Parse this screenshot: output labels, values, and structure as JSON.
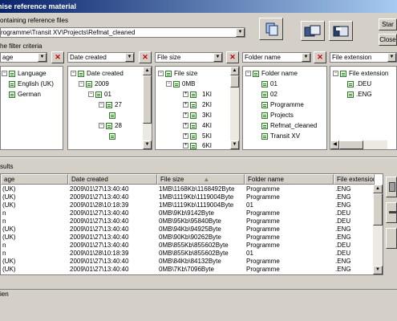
{
  "window": {
    "title": "anise reference material"
  },
  "reference": {
    "label": "ontaining reference files",
    "path": "rogramme\\Transit XV\\Projects\\Refmat_cleaned"
  },
  "buttons": {
    "start": "Star",
    "close": "Close"
  },
  "filter": {
    "label": "he filter criteria",
    "combos": [
      "age",
      "Date created",
      "File size",
      "Folder name",
      "File extension"
    ]
  },
  "trees": {
    "language": {
      "root": "Language",
      "items": [
        "English (UK)",
        "German"
      ]
    },
    "date": {
      "root": "Date created",
      "year": "2009",
      "month": "01",
      "day1": "27",
      "day2": "28"
    },
    "size": {
      "root": "File size",
      "first": "0MB",
      "items": [
        "1KI",
        "2KI",
        "3KI",
        "4KI",
        "5KI",
        "6KI"
      ]
    },
    "folder": {
      "root": "Folder name",
      "items": [
        "01",
        "02",
        "Programme",
        "Projects",
        "Refmat_cleaned",
        "Transit XV"
      ]
    },
    "ext": {
      "root": "File extension",
      "items": [
        ".DEU",
        ".ENG"
      ]
    }
  },
  "results": {
    "label": "sults",
    "columns": [
      "age",
      "Date created",
      "File size",
      "Folder name",
      "File extensior"
    ],
    "rows": [
      [
        "(UK)",
        "2009\\01\\27\\13:40:40",
        "1MB\\1168Kb\\1168492Byte",
        "Programme",
        ".ENG"
      ],
      [
        "(UK)",
        "2009\\01\\27\\13:40:40",
        "1MB\\1119Kb\\1119004Byte",
        "Programme",
        ".ENG"
      ],
      [
        "(UK)",
        "2009\\01\\28\\10:18:39",
        "1MB\\1119Kb\\1119004Byte",
        "01",
        ".ENG"
      ],
      [
        "n",
        "2009\\01\\27\\13:40:40",
        "0MB\\9Kb\\9142Byte",
        "Programme",
        ".DEU"
      ],
      [
        "n",
        "2009\\01\\27\\13:40:40",
        "0MB\\95Kb\\95840Byte",
        "Programme",
        ".DEU"
      ],
      [
        "(UK)",
        "2009\\01\\27\\13:40:40",
        "0MB\\94Kb\\94925Byte",
        "Programme",
        ".ENG"
      ],
      [
        "(UK)",
        "2009\\01\\27\\13:40:40",
        "0MB\\90Kb\\90262Byte",
        "Programme",
        ".ENG"
      ],
      [
        "n",
        "2009\\01\\27\\13:40:40",
        "0MB\\855Kb\\855602Byte",
        "Programme",
        ".DEU"
      ],
      [
        "n",
        "2009\\01\\28\\10:18:39",
        "0MB\\855Kb\\855602Byte",
        "01",
        ".DEU"
      ],
      [
        "(UK)",
        "2009\\01\\27\\13:40:40",
        "0MB\\84Kb\\84132Byte",
        "Programme",
        ".ENG"
      ],
      [
        "(UK)",
        "2009\\01\\27\\13:40:40",
        "0MB\\7Kb\\7096Byte",
        "Programme",
        ".ENG"
      ]
    ]
  },
  "status": {
    "text": "ien"
  }
}
